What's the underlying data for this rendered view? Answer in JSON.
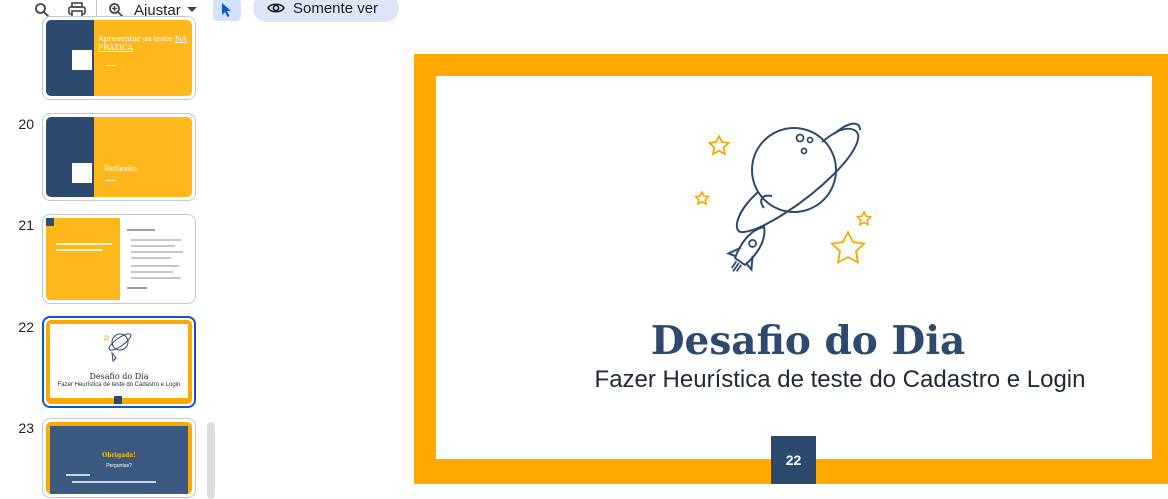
{
  "toolbar": {
    "search_icon": "search-icon",
    "print_icon": "print-icon",
    "zoom_icon": "zoom-in-icon",
    "zoom_label": "Ajustar",
    "pointer_icon": "pointer-icon",
    "view_mode_label": "Somente ver"
  },
  "filmstrip": {
    "slides": [
      {
        "number": "",
        "title_a": "Apresentar os teste ",
        "title_b": "NA PRÁTICA"
      },
      {
        "number": "20",
        "title": "Reflexão"
      },
      {
        "number": "21"
      },
      {
        "number": "22",
        "title": "Desafio do Dia",
        "subtitle": "Fazer Heurística de teste do Cadastro e Login"
      },
      {
        "number": "23",
        "title": "Obrigada!",
        "subtitle": "Perguntas?"
      }
    ]
  },
  "slide": {
    "title": "Desafio do Dia",
    "subtitle": "Fazer Heurística de teste do Cadastro e Login",
    "page_number": "22",
    "colors": {
      "frame": "#ffa800",
      "navy": "#2c4a6e",
      "star": "#f2a900"
    }
  }
}
